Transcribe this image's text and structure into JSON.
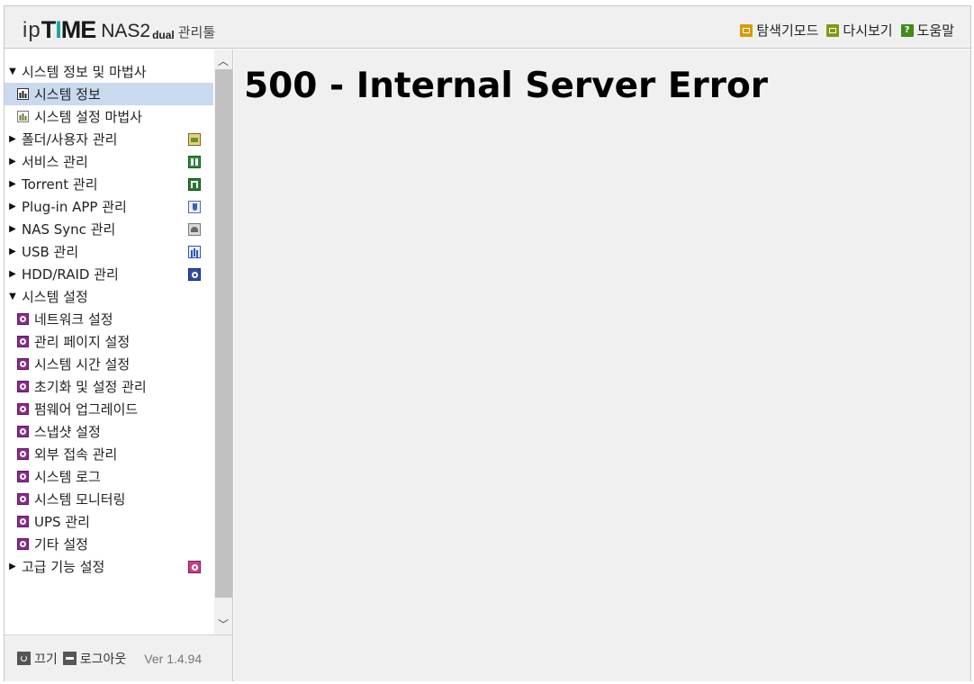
{
  "header": {
    "logo_ip": "ip",
    "logo_t": "T",
    "logo_i": "I",
    "logo_me": "ME",
    "logo_model": "NAS2",
    "logo_dual": "dual",
    "logo_tool": "관리툴",
    "links": [
      {
        "label": "탐색기모드",
        "icon": "explorer-mode-icon",
        "color": "#d99a0a"
      },
      {
        "label": "다시보기",
        "icon": "reload-icon",
        "color": "#7d9a12"
      },
      {
        "label": "도움말",
        "icon": "help-icon",
        "glyph": "?",
        "color": "#3f8c17"
      }
    ]
  },
  "sidebar": {
    "items": [
      {
        "label": "시스템 정보 및 마법사",
        "expanded": true
      },
      {
        "label": "시스템 정보",
        "selected": true
      },
      {
        "label": "시스템 설정 마법사"
      },
      {
        "label": "폴더/사용자 관리"
      },
      {
        "label": "서비스 관리"
      },
      {
        "label": "Torrent 관리"
      },
      {
        "label": "Plug-in APP 관리"
      },
      {
        "label": "NAS Sync 관리"
      },
      {
        "label": "USB 관리"
      },
      {
        "label": "HDD/RAID 관리"
      },
      {
        "label": "시스템 설정",
        "expanded": true
      },
      {
        "label": "네트워크 설정"
      },
      {
        "label": "관리 페이지 설정"
      },
      {
        "label": "시스템 시간 설정"
      },
      {
        "label": "초기화 및 설정 관리"
      },
      {
        "label": "펌웨어 업그레이드"
      },
      {
        "label": "스냅샷 설정"
      },
      {
        "label": "외부 접속 관리"
      },
      {
        "label": "시스템 로그"
      },
      {
        "label": "시스템 모니터링"
      },
      {
        "label": "UPS 관리"
      },
      {
        "label": "기타 설정"
      },
      {
        "label": "고급 기능 설정"
      }
    ],
    "glyphs": {
      "expanded": "▼",
      "collapsed": "▶",
      "scroll_up": "︿",
      "scroll_down": "﹀"
    }
  },
  "footer": {
    "power_label": "끄기",
    "logout_label": "로그아웃",
    "version": "Ver 1.4.94"
  },
  "main": {
    "error_title": "500 - Internal Server Error"
  },
  "colors": {
    "selected_row": "#c9d9ee",
    "logo_accent": "#15a8a4",
    "gear_icon": "#8a2a8f",
    "panel_bg": "#f0f0f0"
  }
}
